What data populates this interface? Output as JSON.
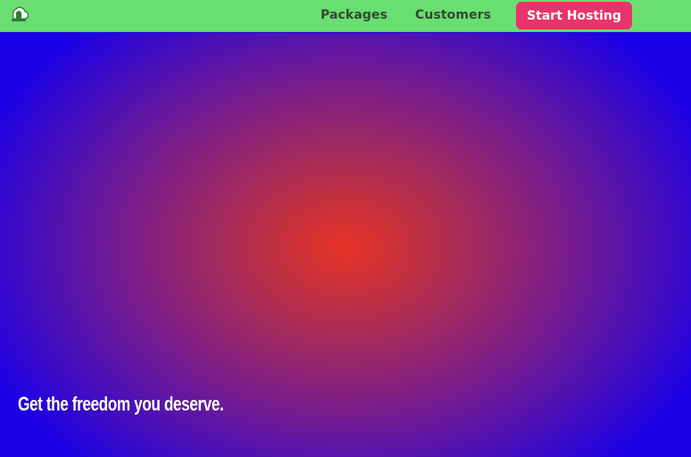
{
  "nav": {
    "logo_icon": "cloud-house-icon",
    "links": [
      {
        "label": "Packages"
      },
      {
        "label": "Customers"
      }
    ],
    "cta_label": "Start Hosting"
  },
  "hero": {
    "tagline": "Get the freedom you deserve."
  },
  "colors": {
    "nav_bg": "#6ade70",
    "cta_bg": "#e8336b",
    "hero_center": "#e83326",
    "hero_edge": "#1a00e6"
  }
}
